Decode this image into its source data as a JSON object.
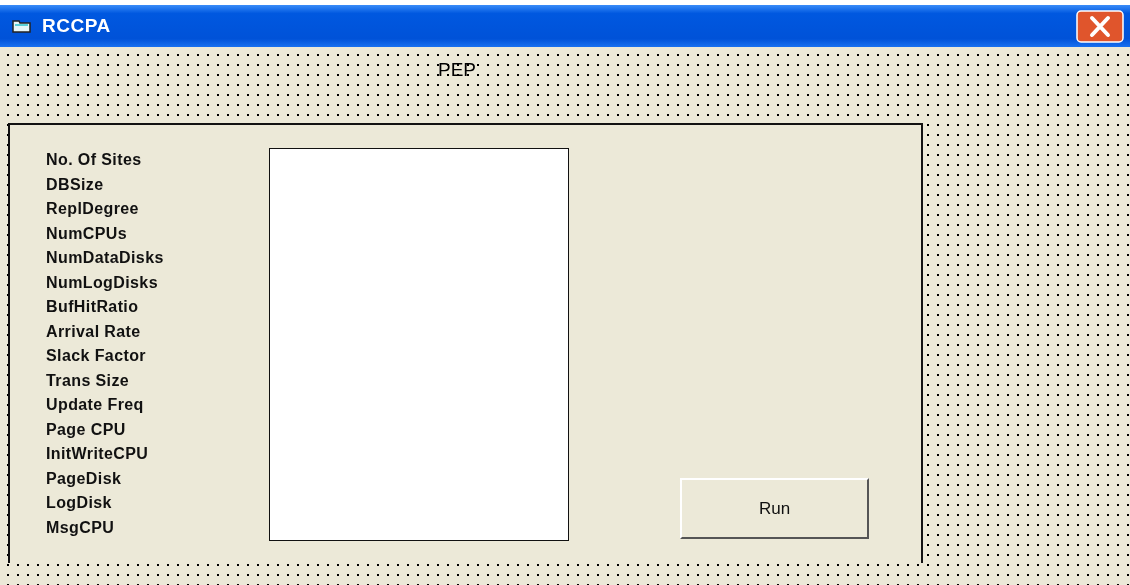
{
  "window": {
    "title": "RCCPA"
  },
  "heading": "PEP",
  "fields": [
    {
      "label": "No. Of Sites"
    },
    {
      "label": "DBSize"
    },
    {
      "label": "ReplDegree"
    },
    {
      "label": "NumCPUs"
    },
    {
      "label": "NumDataDisks"
    },
    {
      "label": "NumLogDisks"
    },
    {
      "label": "BufHitRatio"
    },
    {
      "label": "Arrival Rate"
    },
    {
      "label": "Slack Factor"
    },
    {
      "label": "Trans Size"
    },
    {
      "label": "Update Freq"
    },
    {
      "label": "Page CPU"
    },
    {
      "label": "InitWriteCPU"
    },
    {
      "label": "PageDisk"
    },
    {
      "label": "LogDisk"
    },
    {
      "label": "MsgCPU"
    }
  ],
  "buttons": [
    "Run"
  ]
}
